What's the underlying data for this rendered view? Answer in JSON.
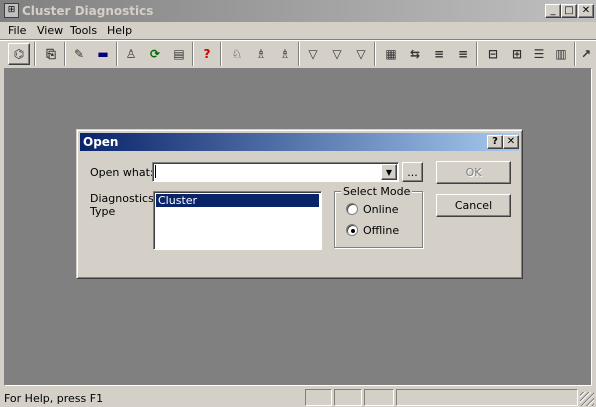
{
  "window": {
    "title": "Cluster Diagnostics",
    "minimize": "_",
    "maximize": "□",
    "close": "✕"
  },
  "menu": [
    {
      "label": "File"
    },
    {
      "label": "View"
    },
    {
      "label": "Tools"
    },
    {
      "label": "Help"
    }
  ],
  "toolbar": {
    "glyphs": [
      "⌬",
      "⎘",
      "✎",
      "▬",
      "♙",
      "⟳",
      "▤",
      "?",
      "♘",
      "♗",
      "♗",
      "▽",
      "▽",
      "▽",
      "▦",
      "⇆",
      "≡",
      "≡",
      "⊟",
      "⊞",
      "☰",
      "▥",
      "↗"
    ],
    "help_color": "#cc0000"
  },
  "status": {
    "text": "For Help, press F1"
  },
  "dialog": {
    "title": "Open",
    "help_button": "?",
    "close_button": "✕",
    "open_what_label": "Open what:",
    "open_what_value": "",
    "browse_button": "...",
    "ok_button": "OK",
    "cancel_button": "Cancel",
    "diagnostics_type_label_line1": "Diagnostics",
    "diagnostics_type_label_line2": "Type",
    "types": [
      {
        "label": "Cluster",
        "selected": true
      }
    ],
    "select_mode_label": "Select Mode",
    "online_label": "Online",
    "offline_label": "Offline",
    "mode_selected": "Offline"
  },
  "colors": {
    "workspace": "#808080",
    "dialog_title_start": "#0a246a",
    "dialog_title_end": "#a6caf0",
    "selection": "#0a246a"
  }
}
